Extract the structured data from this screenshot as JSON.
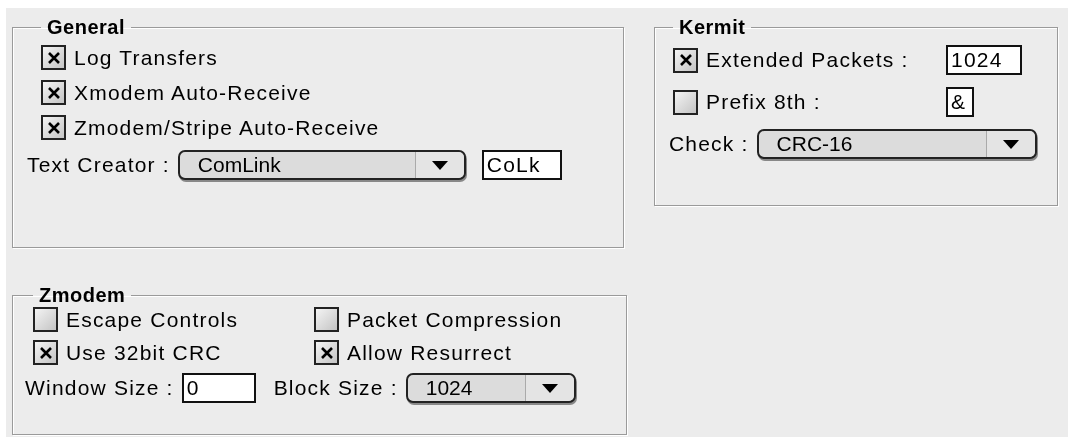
{
  "general": {
    "title": "General",
    "checkboxes": [
      {
        "label": "Log Transfers",
        "checked": true
      },
      {
        "label": "Xmodem Auto-Receive",
        "checked": true
      },
      {
        "label": "Zmodem/Stripe Auto-Receive",
        "checked": true
      }
    ],
    "text_creator": {
      "label": "Text Creator :",
      "value": "ComLink",
      "code": "CoLk"
    }
  },
  "zmodem": {
    "title": "Zmodem",
    "checkboxes": [
      {
        "label": "Escape Controls",
        "checked": false
      },
      {
        "label": "Packet Compression",
        "checked": false
      },
      {
        "label": "Use 32bit CRC",
        "checked": true
      },
      {
        "label": "Allow Resurrect",
        "checked": true
      }
    ],
    "window_size": {
      "label": "Window Size :",
      "value": "0"
    },
    "block_size": {
      "label": "Block Size :",
      "value": "1024"
    }
  },
  "kermit": {
    "title": "Kermit",
    "extended_packets": {
      "label": "Extended Packets :",
      "checked": true,
      "value": "1024"
    },
    "prefix_8th": {
      "label": "Prefix 8th :",
      "checked": false,
      "value": "&"
    },
    "check": {
      "label": "Check :",
      "value": "CRC-16"
    }
  }
}
